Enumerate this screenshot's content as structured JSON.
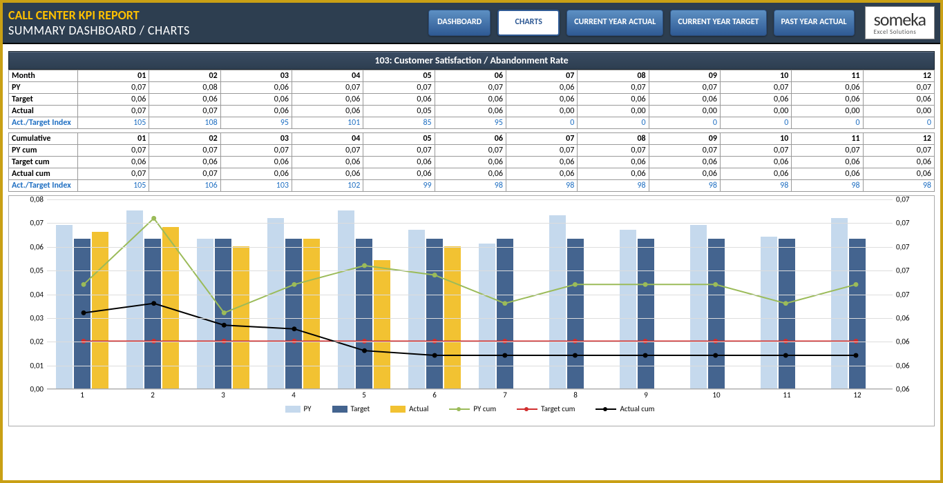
{
  "header": {
    "report_title": "CALL CENTER KPI REPORT",
    "sub_title": "SUMMARY DASHBOARD / CHARTS"
  },
  "nav": {
    "dashboard": "DASHBOARD",
    "charts": "CHARTS",
    "cy_actual": "CURRENT YEAR ACTUAL",
    "cy_target": "CURRENT YEAR TARGET",
    "py_actual": "PAST YEAR ACTUAL"
  },
  "logo": {
    "big": "someka",
    "small": "Excel Solutions"
  },
  "chart_title": "103: Customer Satisfaction / Abandonment Rate",
  "labels": {
    "month": "Month",
    "py": "PY",
    "target": "Target",
    "actual": "Actual",
    "idx": "Act./Target Index",
    "cum": "Cumulative",
    "py_cum": "PY cum",
    "target_cum": "Target cum",
    "actual_cum": "Actual cum"
  },
  "months": [
    "01",
    "02",
    "03",
    "04",
    "05",
    "06",
    "07",
    "08",
    "09",
    "10",
    "11",
    "12"
  ],
  "monthly": {
    "py": [
      "0,07",
      "0,08",
      "0,06",
      "0,07",
      "0,07",
      "0,07",
      "0,06",
      "0,07",
      "0,07",
      "0,07",
      "0,06",
      "0,07"
    ],
    "target": [
      "0,06",
      "0,06",
      "0,06",
      "0,06",
      "0,06",
      "0,06",
      "0,06",
      "0,06",
      "0,06",
      "0,06",
      "0,06",
      "0,06"
    ],
    "actual": [
      "0,07",
      "0,07",
      "0,06",
      "0,06",
      "0,05",
      "0,06",
      "0,00",
      "0,00",
      "0,00",
      "0,00",
      "0,00",
      "0,00"
    ],
    "idx": [
      "105",
      "108",
      "95",
      "101",
      "85",
      "95",
      "0",
      "0",
      "0",
      "0",
      "0",
      "0"
    ]
  },
  "cumulative": {
    "py": [
      "0,07",
      "0,07",
      "0,07",
      "0,07",
      "0,07",
      "0,07",
      "0,07",
      "0,07",
      "0,07",
      "0,07",
      "0,07",
      "0,07"
    ],
    "target": [
      "0,06",
      "0,06",
      "0,06",
      "0,06",
      "0,06",
      "0,06",
      "0,06",
      "0,06",
      "0,06",
      "0,06",
      "0,06",
      "0,06"
    ],
    "actual": [
      "0,07",
      "0,07",
      "0,06",
      "0,06",
      "0,06",
      "0,06",
      "0,06",
      "0,06",
      "0,06",
      "0,06",
      "0,06",
      "0,06"
    ],
    "idx": [
      "105",
      "106",
      "103",
      "102",
      "99",
      "98",
      "98",
      "98",
      "98",
      "98",
      "98",
      "98"
    ]
  },
  "legend": {
    "py": "PY",
    "target": "Target",
    "actual": "Actual",
    "py_cum": "PY cum",
    "target_cum": "Target cum",
    "actual_cum": "Actual cum"
  },
  "chart_data": {
    "type": "bar+line",
    "categories": [
      1,
      2,
      3,
      4,
      5,
      6,
      7,
      8,
      9,
      10,
      11,
      12
    ],
    "y_left": {
      "min": 0.0,
      "max": 0.08,
      "ticks": [
        "0,00",
        "0,01",
        "0,02",
        "0,03",
        "0,04",
        "0,05",
        "0,06",
        "0,07",
        "0,08"
      ]
    },
    "y_right": {
      "min": 0.055,
      "max": 0.075,
      "ticks": [
        "0,06",
        "0,06",
        "0,06",
        "0,06",
        "0,07",
        "0,07",
        "0,07",
        "0,07",
        "0,07"
      ]
    },
    "bar_series": [
      {
        "name": "PY",
        "color": "#c5d9ed",
        "axis": "left",
        "values": [
          0.069,
          0.075,
          0.063,
          0.072,
          0.075,
          0.067,
          0.061,
          0.073,
          0.067,
          0.069,
          0.064,
          0.072
        ]
      },
      {
        "name": "Target",
        "color": "#44648f",
        "axis": "left",
        "values": [
          0.063,
          0.063,
          0.063,
          0.063,
          0.063,
          0.063,
          0.063,
          0.063,
          0.063,
          0.063,
          0.063,
          0.063
        ]
      },
      {
        "name": "Actual",
        "color": "#f2c232",
        "axis": "left",
        "values": [
          0.066,
          0.068,
          0.06,
          0.063,
          0.054,
          0.06,
          0,
          0,
          0,
          0,
          0,
          0
        ]
      }
    ],
    "line_series": [
      {
        "name": "PY cum",
        "color": "#9bbb59",
        "axis": "right",
        "values": [
          0.066,
          0.073,
          0.063,
          0.066,
          0.068,
          0.067,
          0.064,
          0.066,
          0.066,
          0.066,
          0.064,
          0.066
        ]
      },
      {
        "name": "Target cum",
        "color": "#d12e2e",
        "axis": "right",
        "values": [
          0.06,
          0.06,
          0.06,
          0.06,
          0.06,
          0.06,
          0.06,
          0.06,
          0.06,
          0.06,
          0.06,
          0.06
        ]
      },
      {
        "name": "Actual cum",
        "color": "#000000",
        "axis": "right",
        "values": [
          0.063,
          0.064,
          0.0617,
          0.0613,
          0.059,
          0.0585,
          0.0585,
          0.0585,
          0.0585,
          0.0585,
          0.0585,
          0.0585
        ]
      }
    ]
  }
}
